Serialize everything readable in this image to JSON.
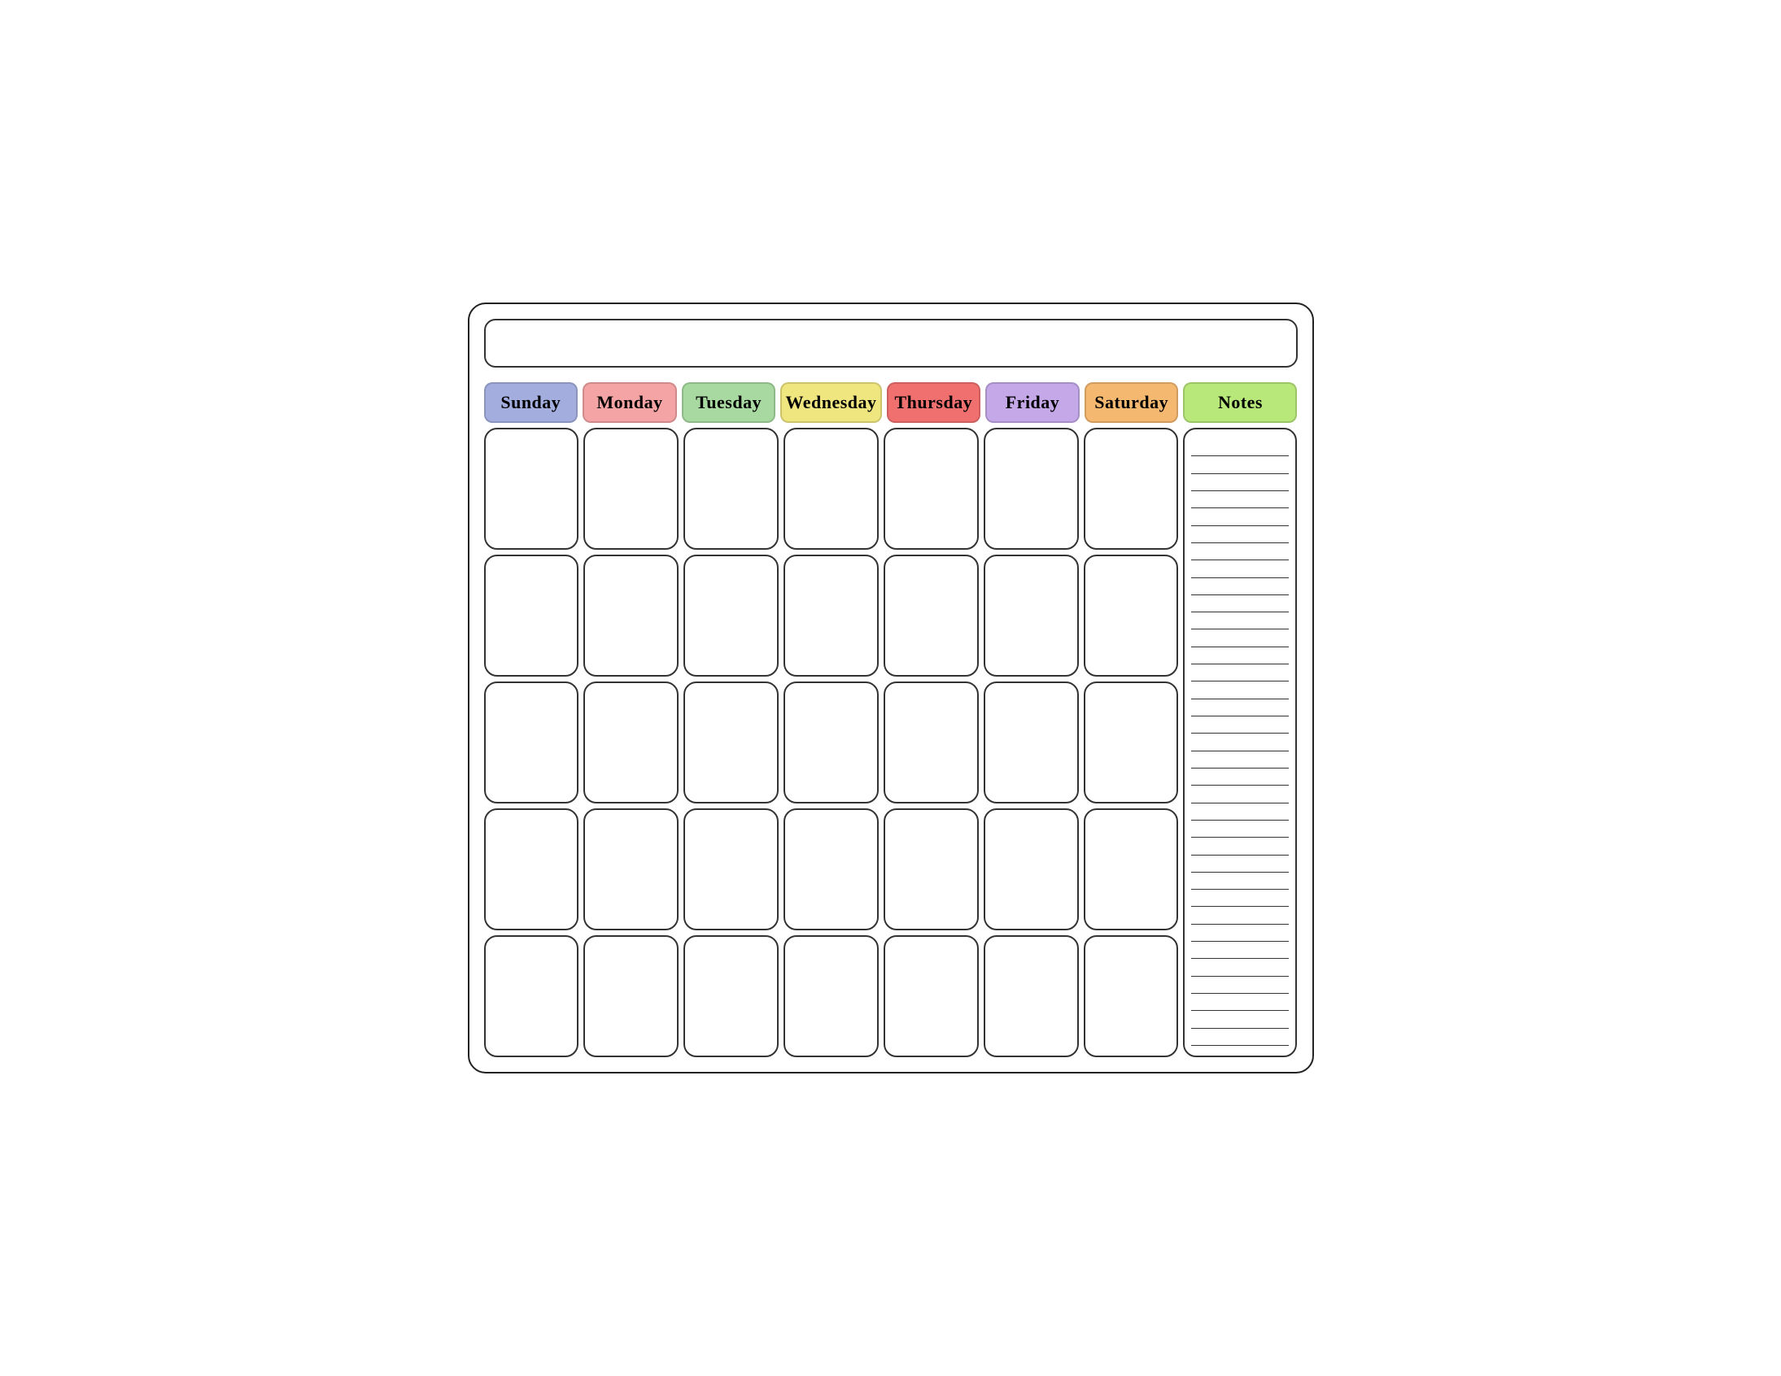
{
  "calendar": {
    "title": "",
    "headers": [
      {
        "label": "Sunday",
        "class": "header-sunday"
      },
      {
        "label": "Monday",
        "class": "header-monday"
      },
      {
        "label": "Tuesday",
        "class": "header-tuesday"
      },
      {
        "label": "Wednesday",
        "class": "header-wednesday"
      },
      {
        "label": "Thursday",
        "class": "header-thursday"
      },
      {
        "label": "Friday",
        "class": "header-friday"
      },
      {
        "label": "Saturday",
        "class": "header-saturday"
      },
      {
        "label": "Notes",
        "class": "header-notes"
      }
    ],
    "rows": 5,
    "cols": 7,
    "note_lines": 35
  }
}
